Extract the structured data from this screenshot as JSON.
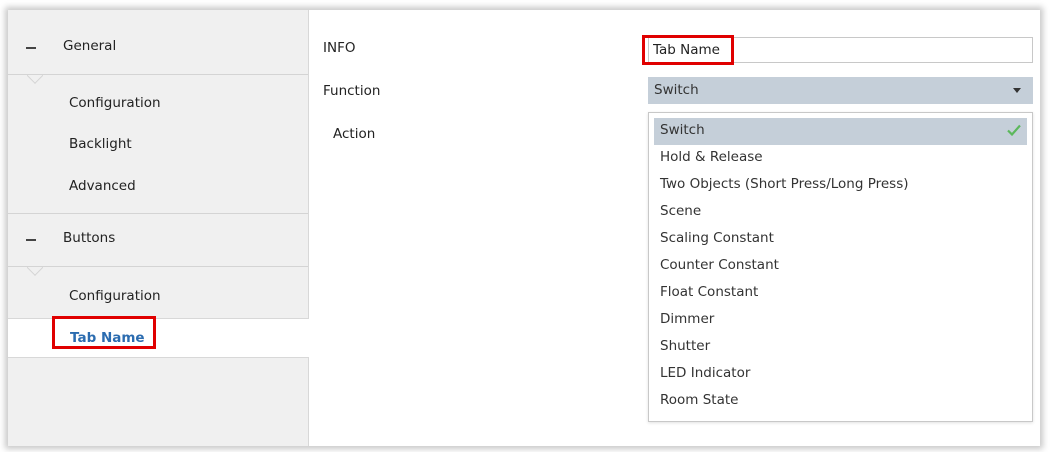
{
  "sidebar": {
    "groups": [
      {
        "label": "General",
        "items": [
          "Configuration",
          "Backlight",
          "Advanced"
        ]
      },
      {
        "label": "Buttons",
        "items": [
          "Configuration",
          "Tab Name"
        ]
      }
    ],
    "active_item": "Tab Name"
  },
  "main": {
    "info_label": "INFO",
    "info_value": "Tab Name",
    "function_label": "Function",
    "function_value": "Switch",
    "action_label": "Action",
    "options": [
      "Switch",
      "Hold & Release",
      "Two Objects (Short Press/Long Press)",
      "Scene",
      "Scaling Constant",
      "Counter Constant",
      "Float Constant",
      "Dimmer",
      "Shutter",
      "LED Indicator",
      "Room State"
    ],
    "selected_option": "Switch"
  },
  "colors": {
    "highlight_box": "#e00000",
    "active_link": "#2b6cb0",
    "selection_bg": "#c5cfd9",
    "check": "#5cb85c"
  },
  "icons": {
    "collapse": "minus-icon",
    "dropdown": "caret-down-icon",
    "selected": "checkmark-icon"
  }
}
